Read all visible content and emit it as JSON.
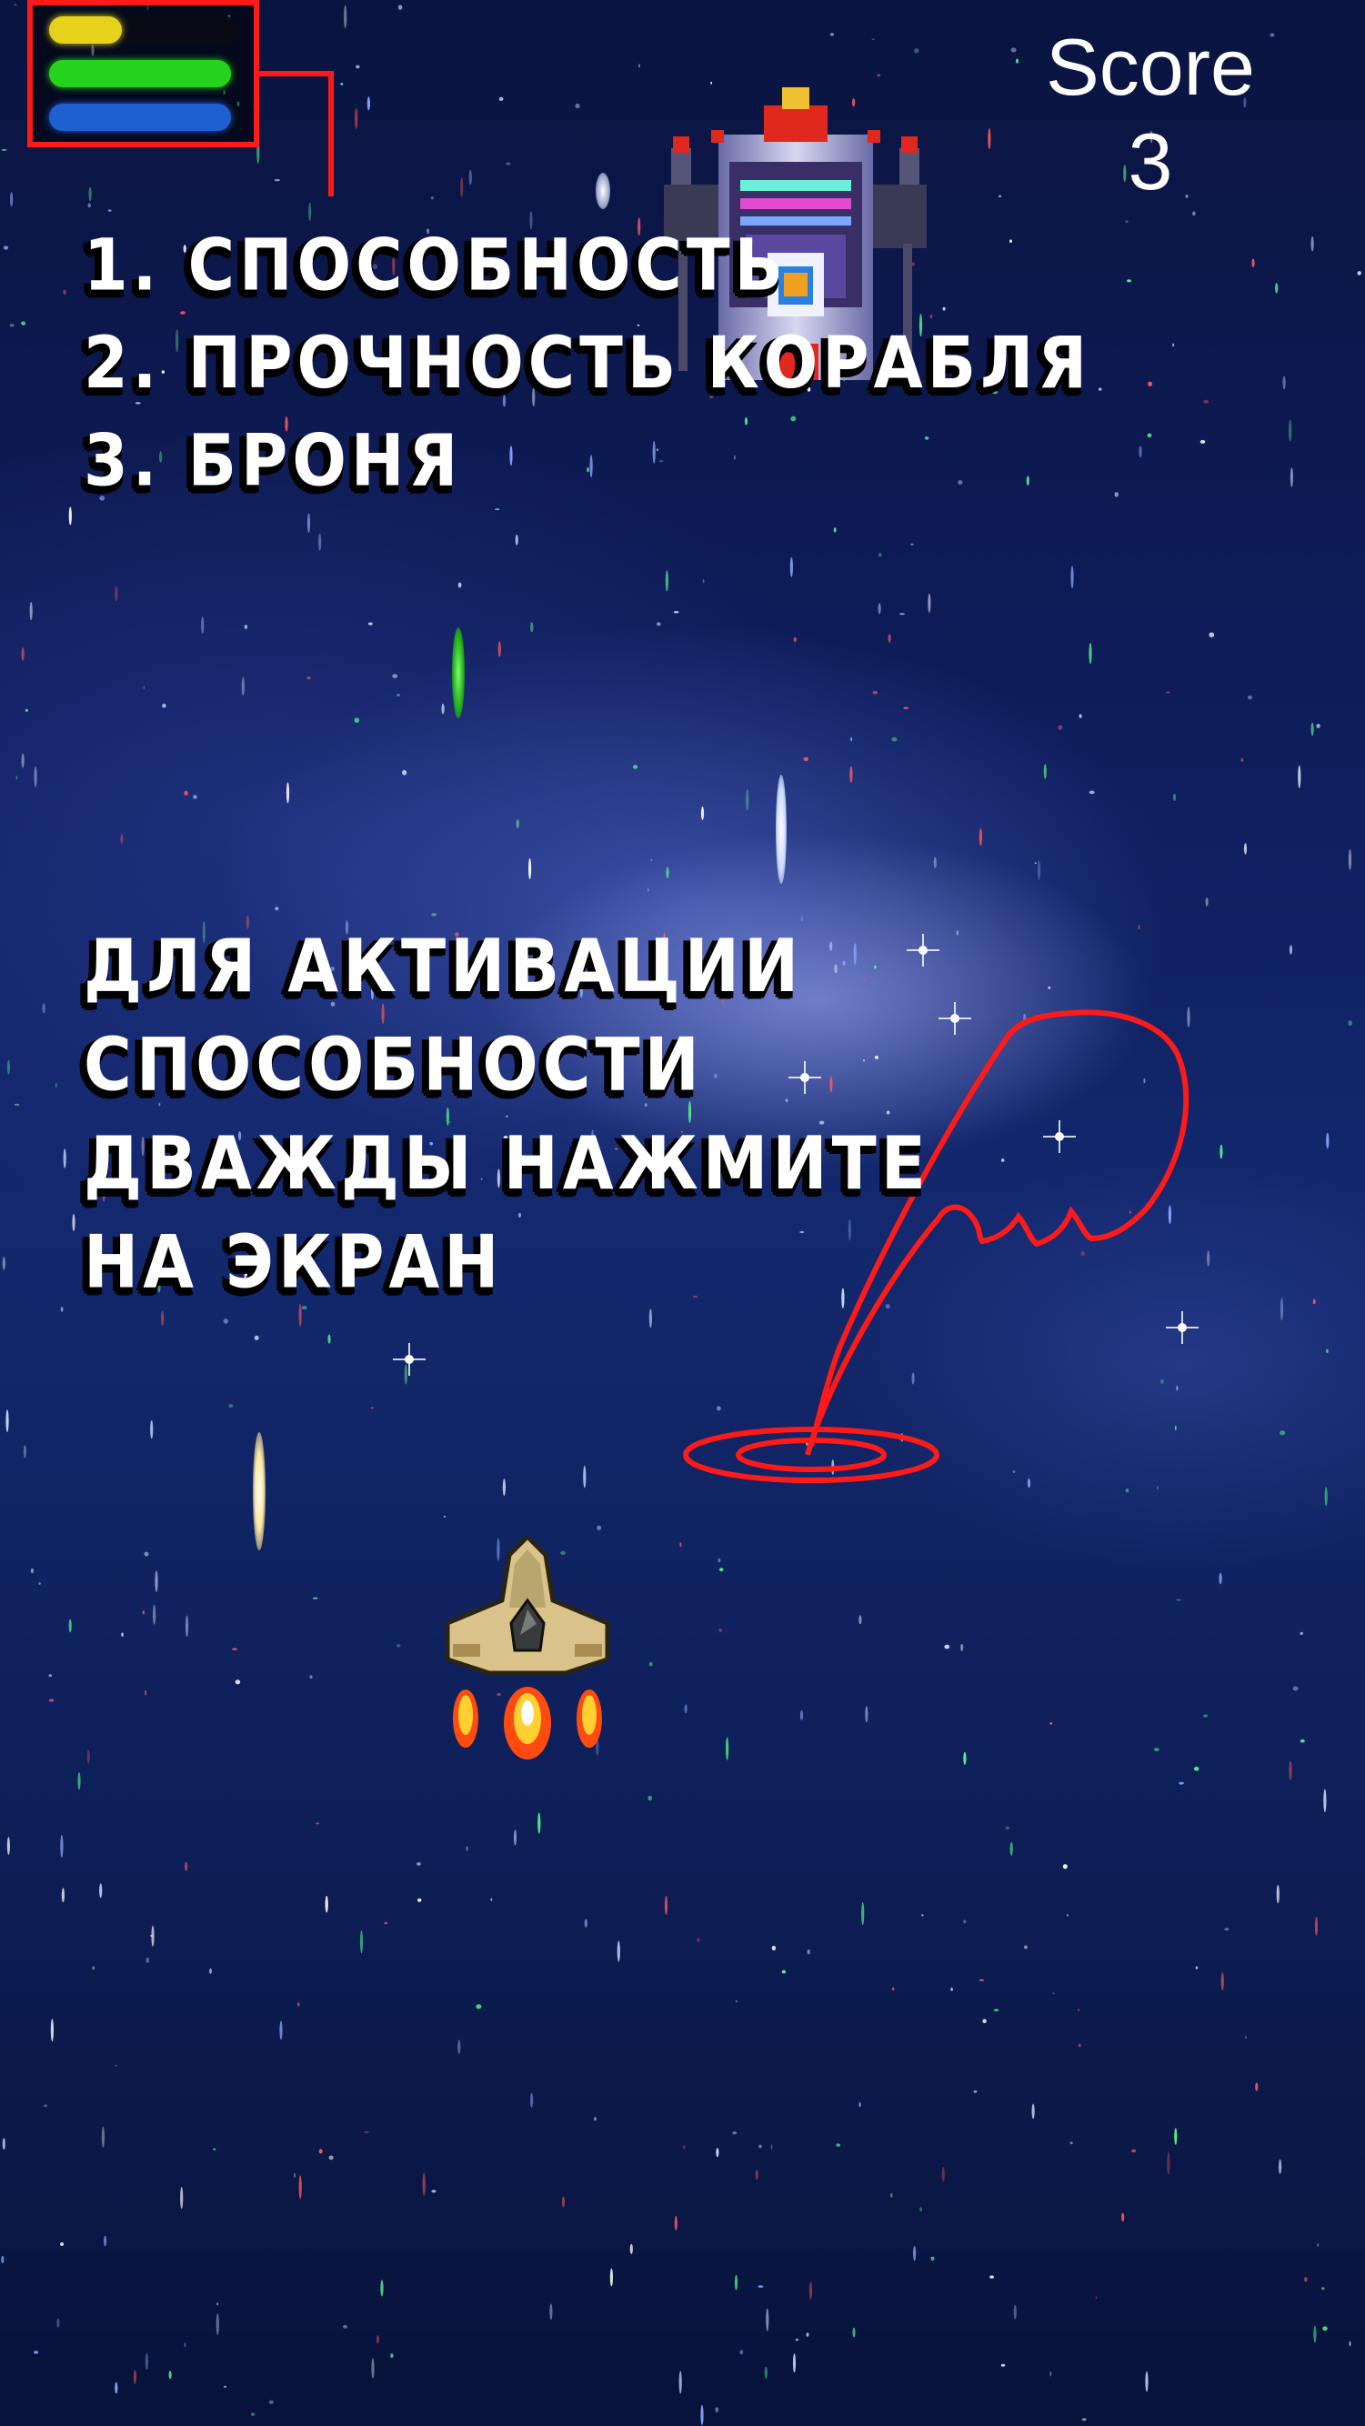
{
  "hud": {
    "bars": [
      {
        "name": "ability",
        "color": "#e6d21a",
        "level": 0.38
      },
      {
        "name": "ship-durability",
        "color": "#25d21e",
        "level": 0.95
      },
      {
        "name": "armor",
        "color": "#1e5fd2",
        "level": 0.95
      }
    ],
    "highlight_color": "#ff1a1a"
  },
  "score": {
    "label": "Score",
    "value": "3"
  },
  "legend": {
    "item_1": "1.  способность",
    "item_2": "2. прочность корабля",
    "item_3": "3. броня"
  },
  "hint": {
    "line_1": "для активации",
    "line_2": "способности",
    "line_3": "дважды нажмите",
    "line_4": "на экран"
  },
  "colors": {
    "background": "#0e1d5c",
    "annotation": "#ff1a1a",
    "text": "#ffffff"
  }
}
